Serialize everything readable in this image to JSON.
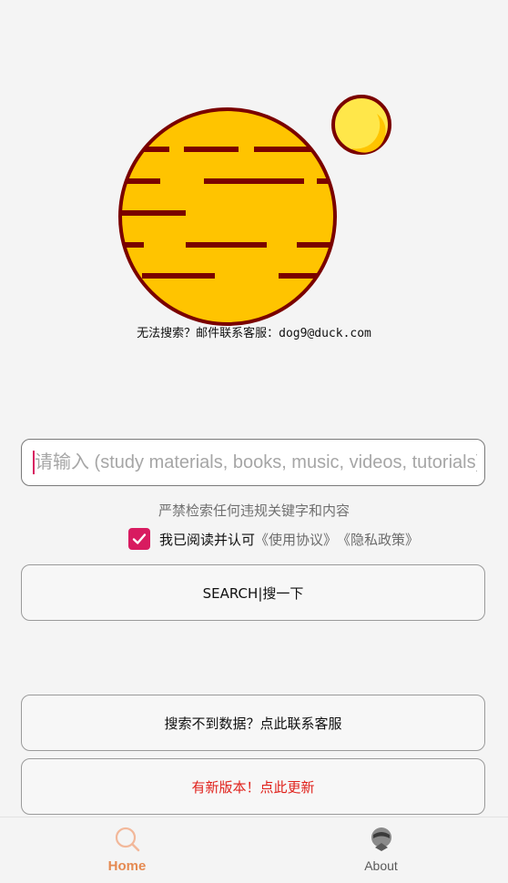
{
  "header": {
    "contact_note": "无法搜索？邮件联系客服：dog9@duck.com"
  },
  "search": {
    "placeholder": "请输入 (study materials, books, music, videos, tutorials)",
    "value": ""
  },
  "notice": {
    "warning": "严禁检索任何违规关键字和内容"
  },
  "agreement": {
    "checked": true,
    "text": "我已阅读并认可",
    "terms_link": "《使用协议》",
    "privacy_link": "《隐私政策》"
  },
  "buttons": {
    "search_label": "SEARCH|搜一下",
    "contact_label": "搜索不到数据？点此联系客服",
    "update_label": "有新版本！点此更新"
  },
  "tabbar": {
    "tabs": [
      {
        "label": "Home",
        "icon": "search-icon",
        "active": true
      },
      {
        "label": "About",
        "icon": "profile-icon",
        "active": false
      }
    ]
  },
  "colors": {
    "accent": "#d81b60",
    "update_text": "#e0221c",
    "tab_active": "#e58a52",
    "logo_fill": "#ffc400",
    "logo_outline": "#7a0000"
  }
}
